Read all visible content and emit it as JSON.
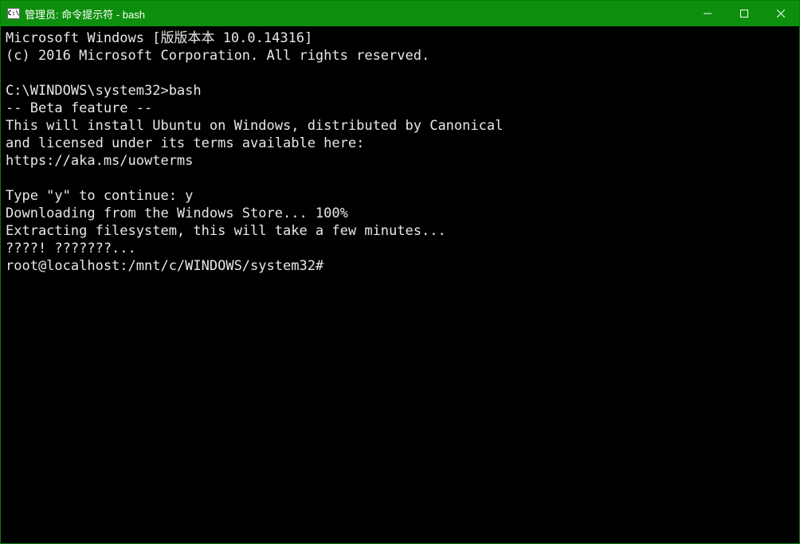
{
  "titlebar": {
    "icon_text": "C:\\",
    "title": "管理员: 命令提示符 - bash"
  },
  "terminal": {
    "lines": [
      "Microsoft Windows [版版本本 10.0.14316]",
      "(c) 2016 Microsoft Corporation. All rights reserved.",
      "",
      "C:\\WINDOWS\\system32>bash",
      "-- Beta feature --",
      "This will install Ubuntu on Windows, distributed by Canonical",
      "and licensed under its terms available here:",
      "https://aka.ms/uowterms",
      "",
      "Type \"y\" to continue: y",
      "Downloading from the Windows Store... 100%",
      "Extracting filesystem, this will take a few minutes...",
      "????! ???????...",
      "root@localhost:/mnt/c/WINDOWS/system32#"
    ]
  }
}
